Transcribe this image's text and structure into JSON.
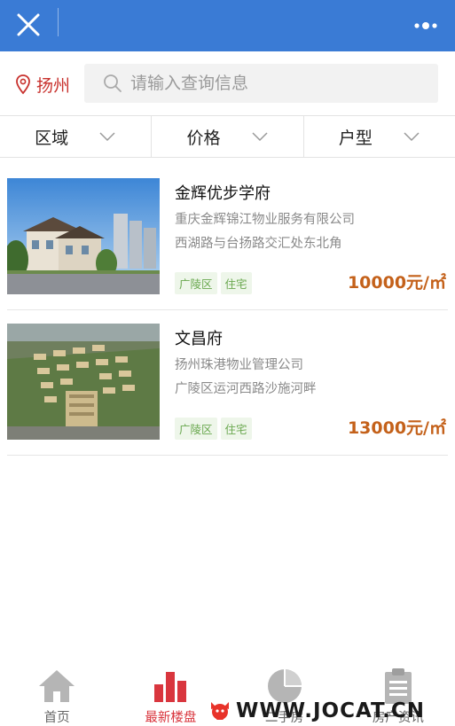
{
  "topbar": {
    "close_icon": "close-icon",
    "more_icon": "more-dots-icon",
    "color": "#3a7bd5"
  },
  "location": {
    "city": "扬州",
    "icon": "location-pin-icon",
    "color": "#c8312d"
  },
  "search": {
    "placeholder": "请输入查询信息",
    "value": "",
    "icon": "search-icon"
  },
  "filters": [
    {
      "label": "区域"
    },
    {
      "label": "价格"
    },
    {
      "label": "户型"
    }
  ],
  "listings": [
    {
      "title": "金辉优步学府",
      "company": "重庆金辉锦江物业服务有限公司",
      "address": "西湖路与台扬路交汇处东北角",
      "tags": [
        "广陵区",
        "住宅"
      ],
      "price": "10000元/㎡"
    },
    {
      "title": "文昌府",
      "company": "扬州珠港物业管理公司",
      "address": "广陵区运河西路沙施河畔",
      "tags": [
        "广陵区",
        "住宅"
      ],
      "price": "13000元/㎡"
    }
  ],
  "tabbar": [
    {
      "label": "首页",
      "icon": "home-icon",
      "active": false
    },
    {
      "label": "最新楼盘",
      "icon": "bar-chart-icon",
      "active": true
    },
    {
      "label": "二手房",
      "icon": "pie-chart-icon",
      "active": false
    },
    {
      "label": "房产资讯",
      "icon": "clipboard-icon",
      "active": false
    }
  ],
  "watermark": {
    "text": "WWW.JOCAT.CN"
  },
  "colors": {
    "accent_red": "#d9363e",
    "price": "#c4611a",
    "tag_green": "#6aa84f"
  }
}
